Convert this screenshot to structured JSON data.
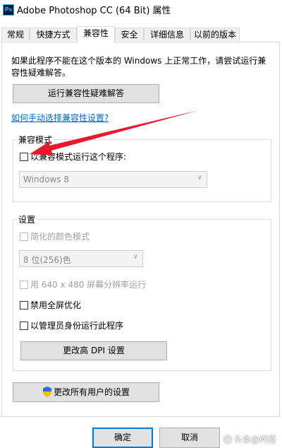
{
  "window": {
    "title": "Adobe Photoshop CC (64 Bit) 属性",
    "app_icon_text": "Ps"
  },
  "tabs": [
    {
      "label": "常规"
    },
    {
      "label": "快捷方式"
    },
    {
      "label": "兼容性",
      "active": true
    },
    {
      "label": "安全"
    },
    {
      "label": "详细信息"
    },
    {
      "label": "以前的版本"
    }
  ],
  "compat": {
    "intro": "如果此程序不能在这个版本的 Windows 上正常工作，请尝试运行兼容性疑难解答。",
    "troubleshoot_button": "运行兼容性疑难解答",
    "manual_link": "如何手动选择兼容性设置?",
    "mode_group": {
      "label": "兼容模式",
      "checkbox": "以兼容模式运行这个程序:",
      "os_select": "Windows 8"
    },
    "settings_group": {
      "label": "设置",
      "reduced_color": "简化的颜色模式",
      "color_select": "8 位(256)色",
      "res_640": "用 640 x 480 屏幕分辨率运行",
      "disable_fullscreen": "禁用全屏优化",
      "run_as_admin": "以管理员身份运行此程序",
      "dpi_button": "更改高 DPI 设置"
    },
    "all_users_button": "更改所有用户的设置"
  },
  "footer": {
    "ok": "确定",
    "cancel": "取消"
  },
  "watermark": "头条@问答",
  "colors": {
    "link": "#0066cc",
    "annotation_arrow": "#e8192c",
    "button_bg": "#e1e1e1",
    "focus_border": "#0078d7"
  }
}
